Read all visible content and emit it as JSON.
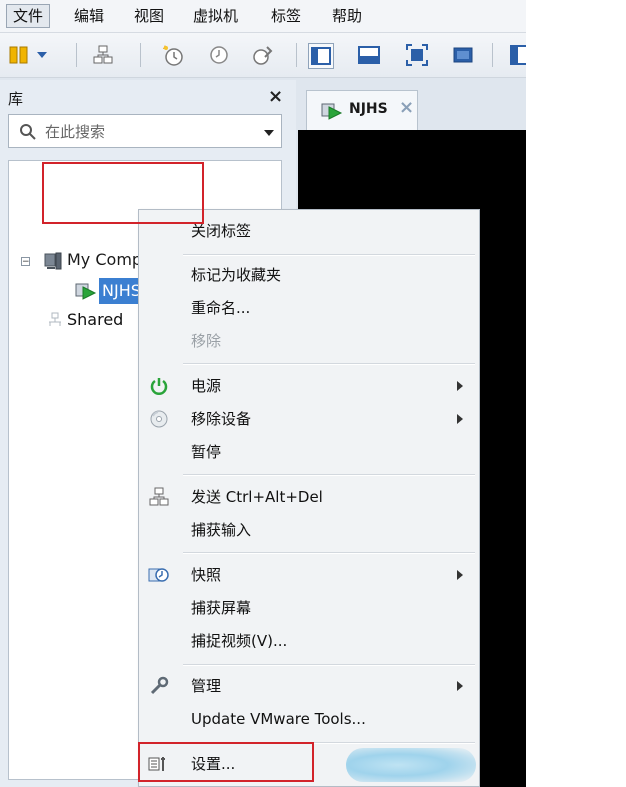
{
  "menubar": {
    "items": [
      {
        "label": "文件",
        "active": true
      },
      {
        "label": "编辑"
      },
      {
        "label": "视图"
      },
      {
        "label": "虚拟机"
      },
      {
        "label": "标签"
      },
      {
        "label": "帮助"
      }
    ]
  },
  "toolbar": {
    "icons": [
      "power-on-icon",
      "dropdown-icon",
      "send-keys-icon",
      "snapshot-icon",
      "revert-snapshot-icon",
      "manage-snapshots-icon",
      "normal-view-icon",
      "full-screen-icon",
      "fit-icon",
      "unity-icon",
      "console-icon"
    ]
  },
  "library": {
    "title": "库",
    "close": "×",
    "search_placeholder": "在此搜索",
    "tree": {
      "root": "My Computer",
      "vm": "NJHS",
      "shared": "Shared"
    }
  },
  "tab": {
    "label": "NJHS",
    "close": "×"
  },
  "context_menu": {
    "close_tab": "关闭标签",
    "favorite": "标记为收藏夹",
    "rename": "重命名...",
    "remove": "移除",
    "power": "电源",
    "remove_device": "移除设备",
    "pause": "暂停",
    "send_cad": "发送 Ctrl+Alt+Del",
    "grab_input": "捕获输入",
    "snapshot": "快照",
    "capture_screen": "捕获屏幕",
    "capture_video": "捕捉视频(V)...",
    "manage": "管理",
    "update_tools": "Update VMware Tools...",
    "settings": "设置..."
  },
  "colors": {
    "highlight_red": "#d2232a",
    "selection_blue": "#3b7fd1",
    "power_green": "#2aa43a"
  }
}
